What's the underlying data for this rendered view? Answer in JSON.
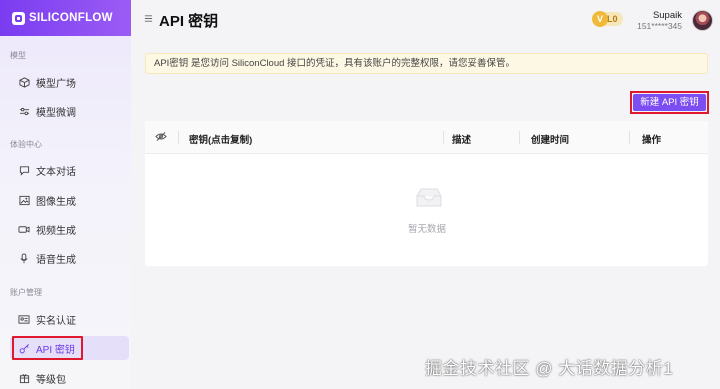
{
  "app": {
    "logo_text": "SILICONFLOW"
  },
  "sidebar": {
    "sections": [
      {
        "title": "模型",
        "items": [
          {
            "label": "模型广场",
            "icon": "cube-icon"
          },
          {
            "label": "模型微调",
            "icon": "sliders-icon"
          }
        ]
      },
      {
        "title": "体验中心",
        "items": [
          {
            "label": "文本对话",
            "icon": "chat-icon"
          },
          {
            "label": "图像生成",
            "icon": "image-icon"
          },
          {
            "label": "视频生成",
            "icon": "video-icon"
          },
          {
            "label": "语音生成",
            "icon": "mic-icon"
          }
        ]
      },
      {
        "title": "账户管理",
        "items": [
          {
            "label": "实名认证",
            "icon": "id-card-icon"
          },
          {
            "label": "API 密钥",
            "icon": "key-icon",
            "active": true
          },
          {
            "label": "等级包",
            "icon": "package-icon"
          }
        ]
      }
    ]
  },
  "header": {
    "title": "API 密钥",
    "level": "L0",
    "level_letter": "V",
    "user_name": "Supaik",
    "user_phone": "151*****345"
  },
  "notice": "API密钥 是您访问 SiliconCloud 接口的凭证，具有该账户的完整权限，请您妥善保管。",
  "actions": {
    "new_key_label": "新建 API 密钥"
  },
  "table": {
    "columns": [
      "密钥(点击复制)",
      "描述",
      "创建时间",
      "操作"
    ],
    "rows": [],
    "empty_text": "暂无数据"
  },
  "watermark": "掘金技术社区 @ 大话数据分析1",
  "colors": {
    "accent": "#7c4df3",
    "highlight_border": "#e0182d",
    "notice_bg": "#fdf8e3"
  }
}
